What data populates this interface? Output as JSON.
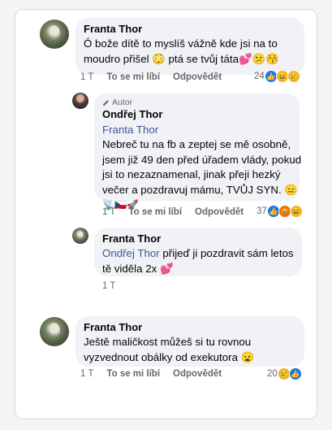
{
  "comments": [
    {
      "author": "Franta Thor",
      "lines": [
        "Ó bože dítě to myslíš vážně kde jsi na to",
        "moudro přišel 😳 ptá se tvůj táta💕😕😚"
      ],
      "time": "1 T",
      "like_label": "To se mi líbí",
      "reply_label": "Odpovědět",
      "reaction_count": "24",
      "reactions": [
        "like",
        "haha",
        "sad"
      ]
    },
    {
      "badge": "Autor",
      "author": "Ondřej Thor",
      "mention": "Franta Thor",
      "lines": [
        "Nebreč tu na fb a zeptej se mě osobně,",
        "jsem již 49 den před úřadem vlády, pokud",
        "jsi to nezaznamenal, jinak přeji hezký",
        "večer a pozdravuj mámu, TVŮJ SYN. 😑",
        "📡🇨🇿🚀"
      ],
      "time": "1 T",
      "like_label": "To se mi líbí",
      "reply_label": "Odpovědět",
      "reaction_count": "37",
      "reactions": [
        "like",
        "angry",
        "haha"
      ]
    },
    {
      "author": "Franta Thor",
      "mention": "Ondřej Thor",
      "first_line_rest": " přijeď ji pozdravit sám letos",
      "lines": [
        "tě viděla 2x 💕"
      ],
      "time": "1 T"
    },
    {
      "author": "Franta Thor",
      "lines": [
        "Ještě maličkost můžeš si tu rovnou",
        "vyzvednout obálky od exekutora 😦"
      ],
      "time": "1 T",
      "like_label": "To se mi líbí",
      "reply_label": "Odpovědět",
      "reaction_count": "20",
      "reactions": [
        "sad",
        "like"
      ]
    }
  ],
  "icons": {
    "pencil": "pencil-icon",
    "like": "like-reaction-icon",
    "haha": "haha-reaction-icon",
    "sad": "sad-reaction-icon",
    "angry": "angry-reaction-icon"
  },
  "colors": {
    "bubble": "#f0f2f5",
    "mention": "#385898",
    "meta": "#65676b",
    "like": "#1877f2"
  }
}
